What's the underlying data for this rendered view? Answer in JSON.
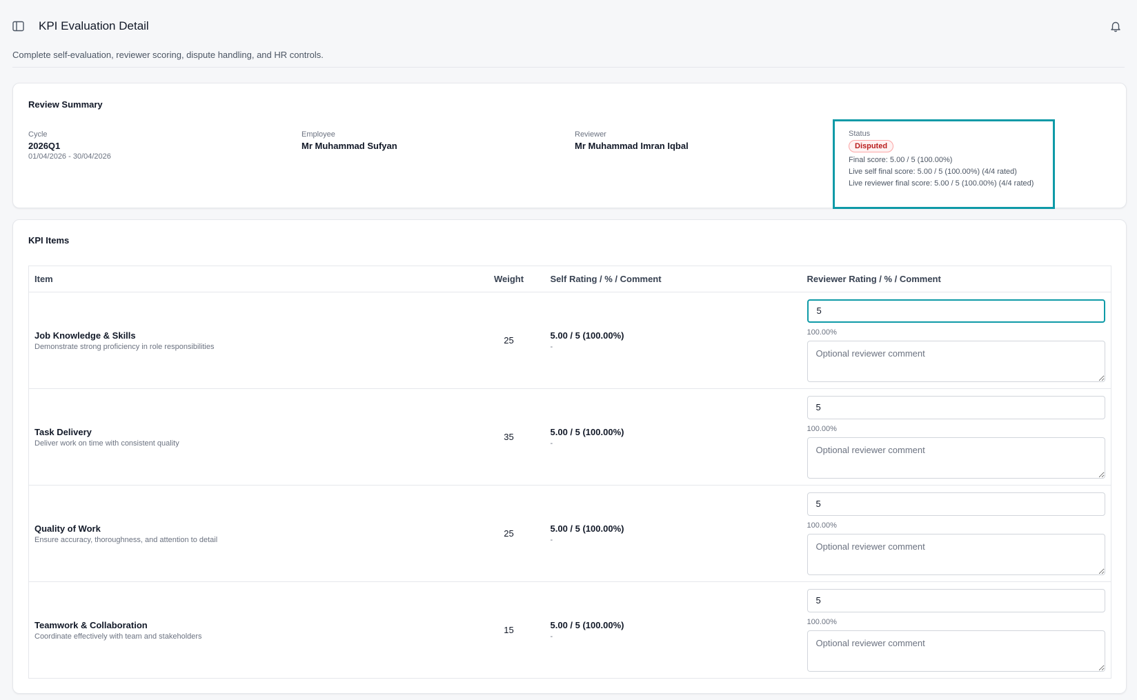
{
  "header": {
    "title": "KPI Evaluation Detail",
    "subtitle": "Complete self-evaluation, reviewer scoring, dispute handling, and HR controls.",
    "sidebar_icon": "sidebar-toggle-icon",
    "bell_icon": "bell-icon"
  },
  "summary": {
    "title": "Review Summary",
    "cycle_label": "Cycle",
    "cycle_value": "2026Q1",
    "cycle_dates": "01/04/2026 - 30/04/2026",
    "employee_label": "Employee",
    "employee_value": "Mr Muhammad Sufyan",
    "reviewer_label": "Reviewer",
    "reviewer_value": "Mr Muhammad Imran Iqbal",
    "status_label": "Status",
    "status_badge": "Disputed",
    "final_score": "Final score: 5.00 / 5 (100.00%)",
    "live_self": "Live self final score: 5.00 / 5 (100.00%) (4/4 rated)",
    "live_reviewer": "Live reviewer final score: 5.00 / 5 (100.00%) (4/4 rated)"
  },
  "kpi": {
    "title": "KPI Items",
    "columns": [
      "Item",
      "Weight",
      "Self Rating / % / Comment",
      "Reviewer Rating / % / Comment"
    ],
    "rows": [
      {
        "name": "Job Knowledge & Skills",
        "desc": "Demonstrate strong proficiency in role responsibilities",
        "weight": "25",
        "self_score": "5.00 / 5 (100.00%)",
        "self_comment": "-",
        "reviewer_rating": "5",
        "reviewer_pct": "100.00%",
        "comment_placeholder": "Optional reviewer comment"
      },
      {
        "name": "Task Delivery",
        "desc": "Deliver work on time with consistent quality",
        "weight": "35",
        "self_score": "5.00 / 5 (100.00%)",
        "self_comment": "-",
        "reviewer_rating": "5",
        "reviewer_pct": "100.00%",
        "comment_placeholder": "Optional reviewer comment"
      },
      {
        "name": "Quality of Work",
        "desc": "Ensure accuracy, thoroughness, and attention to detail",
        "weight": "25",
        "self_score": "5.00 / 5 (100.00%)",
        "self_comment": "-",
        "reviewer_rating": "5",
        "reviewer_pct": "100.00%",
        "comment_placeholder": "Optional reviewer comment"
      },
      {
        "name": "Teamwork & Collaboration",
        "desc": "Coordinate effectively with team and stakeholders",
        "weight": "15",
        "self_score": "5.00 / 5 (100.00%)",
        "self_comment": "-",
        "reviewer_rating": "5",
        "reviewer_pct": "100.00%",
        "comment_placeholder": "Optional reviewer comment"
      }
    ]
  },
  "colors": {
    "accent": "#0e9aa7",
    "status_disputed": "#b91c1c"
  }
}
